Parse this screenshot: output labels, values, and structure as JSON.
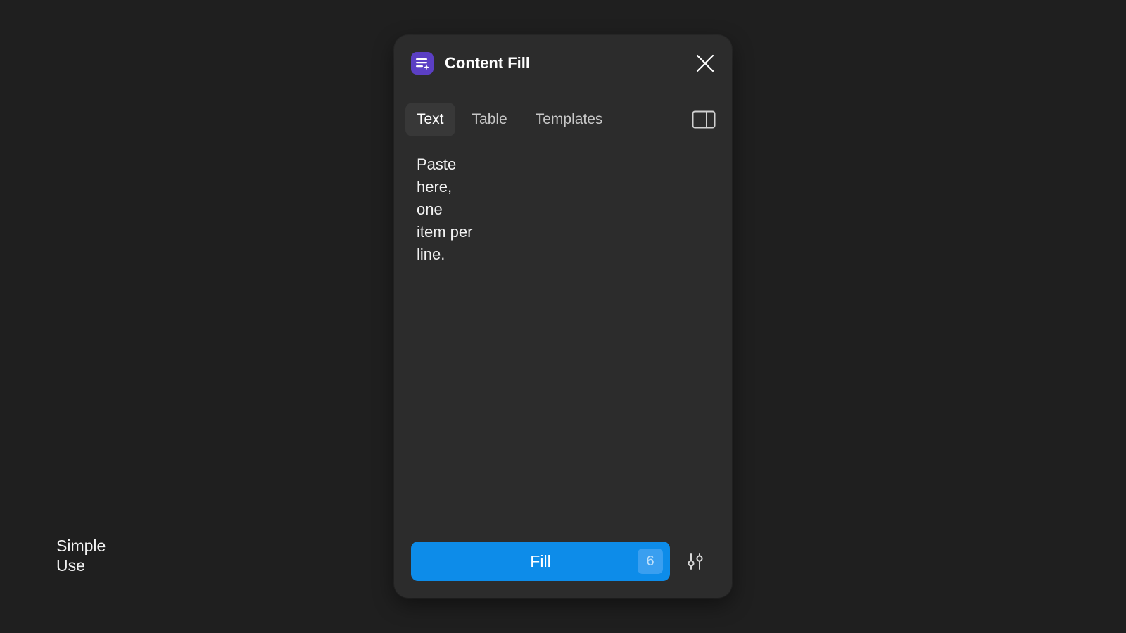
{
  "caption": "Simple\nUse",
  "plugin": {
    "title": "Content Fill",
    "app_icon": "text-lines-sparkle-icon",
    "accent_color": "#5b3fc4"
  },
  "tabs": [
    {
      "label": "Text",
      "active": true
    },
    {
      "label": "Table",
      "active": false
    },
    {
      "label": "Templates",
      "active": false
    }
  ],
  "textarea": {
    "placeholder": "Paste here, one item per line."
  },
  "footer": {
    "fill_label": "Fill",
    "count": "6",
    "button_color": "#0d8ce9"
  },
  "icons": {
    "close": "close-icon",
    "panel": "sidebar-panel-icon",
    "settings": "sliders-icon"
  }
}
